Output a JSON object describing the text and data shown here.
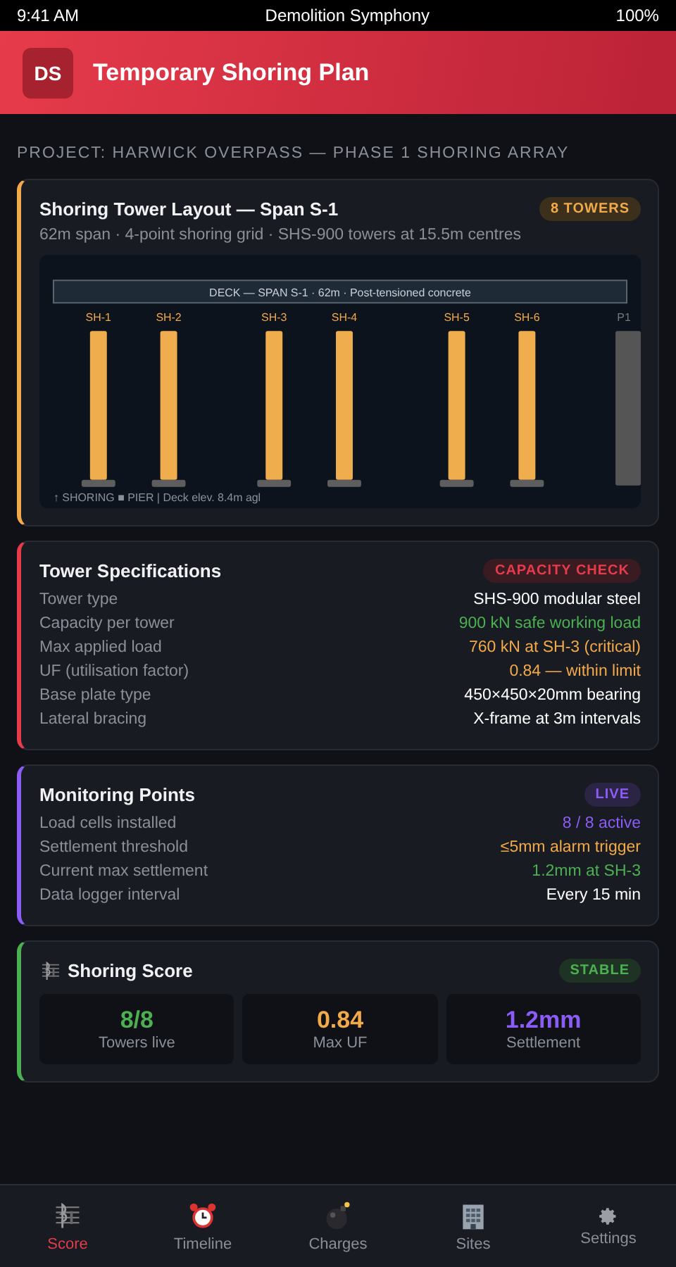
{
  "status_bar": {
    "time": "9:41 AM",
    "title": "Demolition Symphony",
    "battery": "100%"
  },
  "header": {
    "logo": "DS",
    "title": "Temporary Shoring Plan"
  },
  "project": "PROJECT: HARWICK OVERPASS — PHASE 1 SHORING ARRAY",
  "layout_card": {
    "title": "Shoring Tower Layout — Span S-1",
    "badge": "8 TOWERS",
    "subtitle": "62m span · 4-point shoring grid · SHS-900 towers at 15.5m centres",
    "diagram": {
      "deck": "DECK — SPAN S-1 · 62m · Post-tensioned concrete",
      "towers": [
        {
          "label": "SH-1"
        },
        {
          "label": "SH-2"
        },
        {
          "label": "SH-3"
        },
        {
          "label": "SH-4"
        },
        {
          "label": "SH-5"
        },
        {
          "label": "SH-6"
        }
      ],
      "pier": "P1",
      "legend": "↑ SHORING ■ PIER | Deck elev. 8.4m agl"
    }
  },
  "spec_card": {
    "title": "Tower Specifications",
    "badge": "CAPACITY CHECK",
    "rows": [
      {
        "label": "Tower type",
        "value": "SHS-900 modular steel",
        "color": "#ffffff"
      },
      {
        "label": "Capacity per tower",
        "value": "900 kN safe working load",
        "color": "#4cb052"
      },
      {
        "label": "Max applied load",
        "value": "760 kN at SH-3 (critical)",
        "color": "#f2a94a"
      },
      {
        "label": "UF (utilisation factor)",
        "value": "0.84 — within limit",
        "color": "#f2a94a"
      },
      {
        "label": "Base plate type",
        "value": "450×450×20mm bearing",
        "color": "#ffffff"
      },
      {
        "label": "Lateral bracing",
        "value": "X-frame at 3m intervals",
        "color": "#ffffff"
      }
    ]
  },
  "monitor_card": {
    "title": "Monitoring Points",
    "badge": "LIVE",
    "rows": [
      {
        "label": "Load cells installed",
        "value": "8 / 8 active",
        "color": "#8b5cf6"
      },
      {
        "label": "Settlement threshold",
        "value": "≤5mm alarm trigger",
        "color": "#f2a94a"
      },
      {
        "label": "Current max settlement",
        "value": "1.2mm at SH-3",
        "color": "#4cb052"
      },
      {
        "label": "Data logger interval",
        "value": "Every 15 min",
        "color": "#ffffff"
      }
    ]
  },
  "score_card": {
    "title": "Shoring Score",
    "badge": "STABLE",
    "stats": [
      {
        "value": "8/8",
        "label": "Towers live",
        "color": "#4cb052"
      },
      {
        "value": "0.84",
        "label": "Max UF",
        "color": "#f2a94a"
      },
      {
        "value": "1.2mm",
        "label": "Settlement",
        "color": "#8b5cf6"
      }
    ]
  },
  "tabs": [
    {
      "label": "Score",
      "selected": true
    },
    {
      "label": "Timeline",
      "selected": false
    },
    {
      "label": "Charges",
      "selected": false
    },
    {
      "label": "Sites",
      "selected": false
    },
    {
      "label": "Settings",
      "selected": false
    }
  ]
}
